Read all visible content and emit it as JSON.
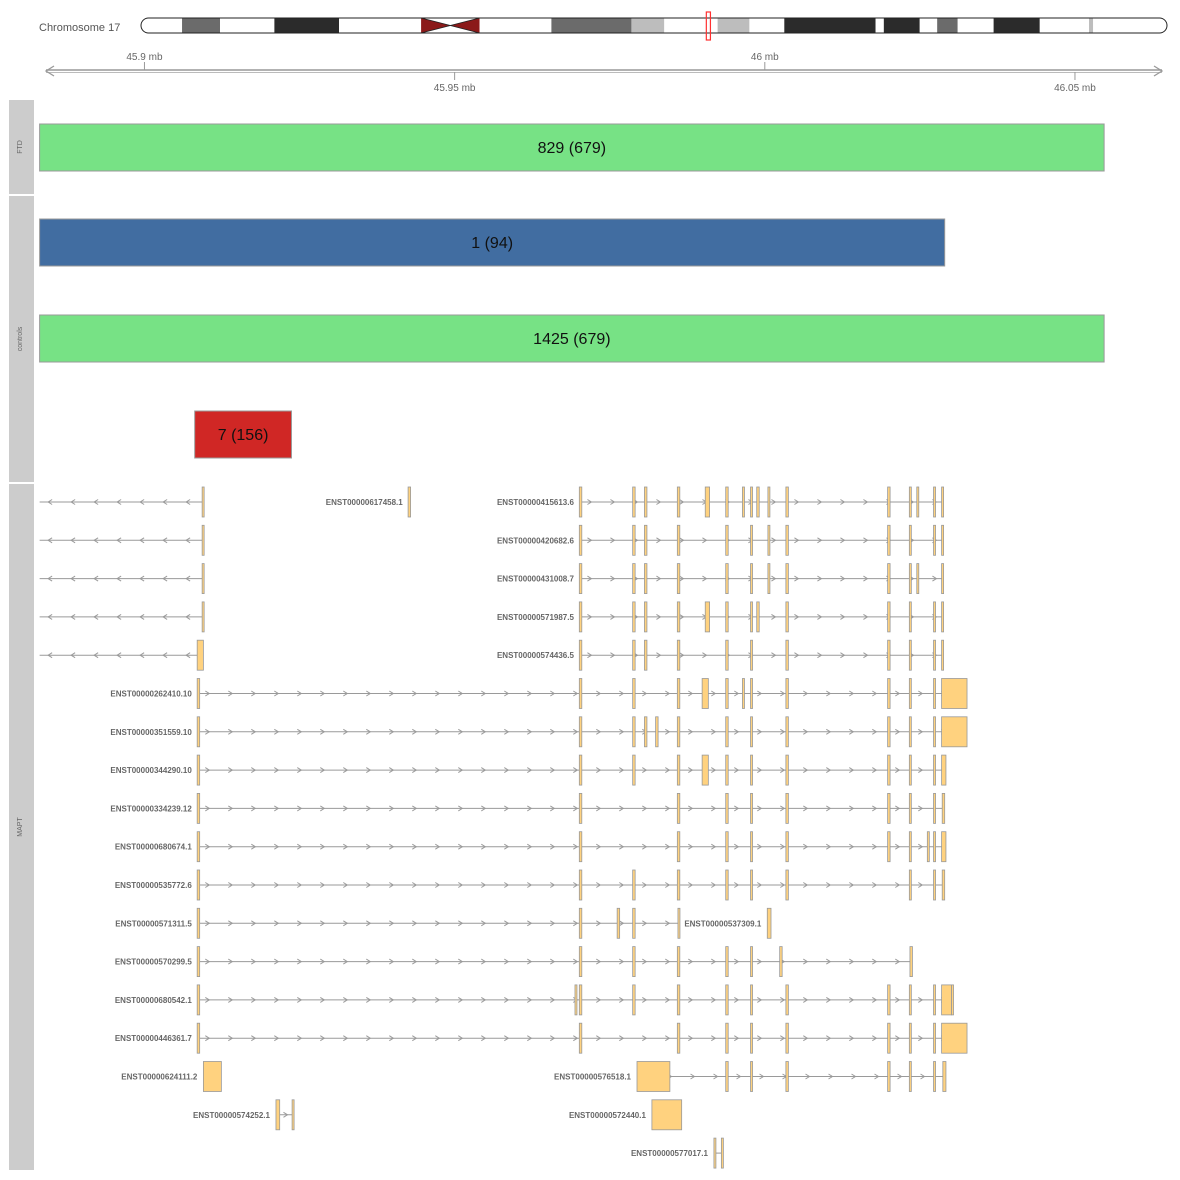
{
  "ideogram": {
    "chromosome_label": "Chromosome 17",
    "centromere_color": "#8b1a1a",
    "highlight_color": "#ff3030",
    "bands": [
      {
        "start": 0.0,
        "end": 0.04,
        "stain": "white"
      },
      {
        "start": 0.04,
        "end": 0.077,
        "stain": "gray"
      },
      {
        "start": 0.077,
        "end": 0.13,
        "stain": "white"
      },
      {
        "start": 0.13,
        "end": 0.193,
        "stain": "black"
      },
      {
        "start": 0.193,
        "end": 0.273,
        "stain": "white"
      },
      {
        "start": 0.273,
        "end": 0.33,
        "stain": "centromere"
      },
      {
        "start": 0.33,
        "end": 0.4,
        "stain": "white"
      },
      {
        "start": 0.4,
        "end": 0.478,
        "stain": "gray"
      },
      {
        "start": 0.478,
        "end": 0.51,
        "stain": "lightgray"
      },
      {
        "start": 0.51,
        "end": 0.562,
        "stain": "white"
      },
      {
        "start": 0.562,
        "end": 0.593,
        "stain": "lightgray"
      },
      {
        "start": 0.593,
        "end": 0.627,
        "stain": "white"
      },
      {
        "start": 0.627,
        "end": 0.716,
        "stain": "black"
      },
      {
        "start": 0.716,
        "end": 0.724,
        "stain": "white"
      },
      {
        "start": 0.724,
        "end": 0.759,
        "stain": "black"
      },
      {
        "start": 0.759,
        "end": 0.776,
        "stain": "white"
      },
      {
        "start": 0.776,
        "end": 0.796,
        "stain": "gray"
      },
      {
        "start": 0.796,
        "end": 0.831,
        "stain": "white"
      },
      {
        "start": 0.831,
        "end": 0.876,
        "stain": "black"
      },
      {
        "start": 0.876,
        "end": 0.924,
        "stain": "white"
      },
      {
        "start": 0.924,
        "end": 0.928,
        "stain": "lightgray"
      },
      {
        "start": 0.928,
        "end": 1.0,
        "stain": "white"
      }
    ],
    "highlight": {
      "start": 0.551,
      "end": 0.555
    }
  },
  "axis": {
    "domain_mb": [
      45.883,
      46.06
    ],
    "ticks_top": [
      {
        "value": 45.9,
        "label": "45.9 mb"
      },
      {
        "value": 46.0,
        "label": "46 mb"
      }
    ],
    "ticks_bottom": [
      {
        "value": 45.95,
        "label": "45.95 mb"
      },
      {
        "value": 46.05,
        "label": "46.05 mb"
      }
    ]
  },
  "tracks": [
    {
      "name": "FTD"
    },
    {
      "name": "controls"
    },
    {
      "name": "MAPT"
    }
  ],
  "data_tracks": [
    {
      "track": "FTD",
      "label": "829 (679)",
      "start": 45.8831,
      "end": 46.0547,
      "color": "#77e285"
    },
    {
      "track": "controls",
      "label": "1 (94)",
      "start": 45.8831,
      "end": 46.029,
      "color": "#416da1"
    },
    {
      "track": "controls",
      "label": "1425 (679)",
      "start": 45.8831,
      "end": 46.0547,
      "color": "#77e285"
    },
    {
      "track": "controls",
      "label": "7 (156)",
      "start": 45.9081,
      "end": 45.9237,
      "color": "#d02725"
    }
  ],
  "transcripts": [
    {
      "id": "",
      "row": 0,
      "strand": "-",
      "start": 45.8831,
      "end": 45.9095,
      "exons": [
        [
          45.9093,
          45.9096
        ]
      ]
    },
    {
      "id": "ENST00000617458.1",
      "row": 0,
      "strand": "+",
      "start": 45.9426,
      "end": 45.9428,
      "exons": [
        [
          45.9425,
          45.9429
        ]
      ]
    },
    {
      "id": "ENST00000415613.6",
      "row": 0,
      "strand": "+",
      "start": 45.9702,
      "end": 46.0287,
      "exons": [
        [
          45.9701,
          45.9705
        ],
        [
          45.9787,
          45.9791
        ],
        [
          45.9806,
          45.981
        ],
        [
          45.9859,
          45.9863
        ],
        [
          45.9904,
          45.9911
        ],
        [
          45.9937,
          45.9941
        ],
        [
          45.9964,
          45.9967
        ],
        [
          45.9977,
          45.998
        ],
        [
          45.9987,
          45.9991
        ],
        [
          46.0005,
          46.0008
        ],
        [
          46.0034,
          46.0038
        ],
        [
          46.0198,
          46.0202
        ],
        [
          46.0233,
          46.0236
        ],
        [
          46.0245,
          46.0248
        ],
        [
          46.0272,
          46.0275
        ],
        [
          46.0285,
          46.0288
        ]
      ]
    },
    {
      "id": "",
      "row": 1,
      "strand": "-",
      "start": 45.8831,
      "end": 45.9095,
      "exons": [
        [
          45.9093,
          45.9096
        ]
      ]
    },
    {
      "id": "ENST00000420682.6",
      "row": 1,
      "strand": "+",
      "start": 45.9702,
      "end": 46.0287,
      "exons": [
        [
          45.9701,
          45.9705
        ],
        [
          45.9787,
          45.9791
        ],
        [
          45.9806,
          45.981
        ],
        [
          45.9859,
          45.9863
        ],
        [
          45.9937,
          45.9941
        ],
        [
          45.9977,
          45.998
        ],
        [
          46.0005,
          46.0008
        ],
        [
          46.0034,
          46.0038
        ],
        [
          46.0198,
          46.0202
        ],
        [
          46.0233,
          46.0236
        ],
        [
          46.0272,
          46.0275
        ],
        [
          46.0285,
          46.0288
        ]
      ]
    },
    {
      "id": "",
      "row": 2,
      "strand": "-",
      "start": 45.8831,
      "end": 45.9095,
      "exons": [
        [
          45.9093,
          45.9096
        ]
      ]
    },
    {
      "id": "ENST00000431008.7",
      "row": 2,
      "strand": "+",
      "start": 45.9702,
      "end": 46.0287,
      "exons": [
        [
          45.9701,
          45.9705
        ],
        [
          45.9787,
          45.9791
        ],
        [
          45.9806,
          45.981
        ],
        [
          45.9859,
          45.9863
        ],
        [
          45.9937,
          45.9941
        ],
        [
          45.9977,
          45.998
        ],
        [
          46.0005,
          46.0008
        ],
        [
          46.0034,
          46.0038
        ],
        [
          46.0198,
          46.0202
        ],
        [
          46.0233,
          46.0236
        ],
        [
          46.0245,
          46.0248
        ],
        [
          46.0285,
          46.0288
        ]
      ]
    },
    {
      "id": "",
      "row": 3,
      "strand": "-",
      "start": 45.8831,
      "end": 45.9095,
      "exons": [
        [
          45.9093,
          45.9096
        ]
      ]
    },
    {
      "id": "ENST00000571987.5",
      "row": 3,
      "strand": "+",
      "start": 45.9702,
      "end": 46.0287,
      "exons": [
        [
          45.9701,
          45.9705
        ],
        [
          45.9787,
          45.9791
        ],
        [
          45.9806,
          45.981
        ],
        [
          45.9859,
          45.9863
        ],
        [
          45.9904,
          45.9911
        ],
        [
          45.9937,
          45.9941
        ],
        [
          45.9977,
          45.998
        ],
        [
          45.9987,
          45.9991
        ],
        [
          46.0034,
          46.0038
        ],
        [
          46.0198,
          46.0202
        ],
        [
          46.0233,
          46.0236
        ],
        [
          46.0272,
          46.0275
        ],
        [
          46.0285,
          46.0288
        ]
      ]
    },
    {
      "id": "",
      "row": 4,
      "strand": "-",
      "start": 45.8831,
      "end": 45.9095,
      "exons": [
        [
          45.9085,
          45.9095
        ]
      ]
    },
    {
      "id": "ENST00000574436.5",
      "row": 4,
      "strand": "+",
      "start": 45.9702,
      "end": 46.0287,
      "exons": [
        [
          45.9701,
          45.9705
        ],
        [
          45.9787,
          45.9791
        ],
        [
          45.9806,
          45.981
        ],
        [
          45.9859,
          45.9863
        ],
        [
          45.9937,
          45.9941
        ],
        [
          45.9977,
          45.998
        ],
        [
          46.0034,
          46.0038
        ],
        [
          46.0198,
          46.0202
        ],
        [
          46.0233,
          46.0236
        ],
        [
          46.0272,
          46.0275
        ],
        [
          46.0285,
          46.0288
        ]
      ]
    },
    {
      "id": "ENST00000262410.10",
      "row": 5,
      "strand": "+",
      "start": 45.9086,
      "end": 46.0326,
      "exons": [
        [
          45.9085,
          45.9089
        ],
        [
          45.9701,
          45.9705
        ],
        [
          45.9787,
          45.9791
        ],
        [
          45.9859,
          45.9863
        ],
        [
          45.9899,
          45.9909
        ],
        [
          45.9937,
          45.9941
        ],
        [
          45.9964,
          45.9967
        ],
        [
          45.9977,
          45.998
        ],
        [
          46.0034,
          46.0038
        ],
        [
          46.0198,
          46.0202
        ],
        [
          46.0233,
          46.0236
        ],
        [
          46.0272,
          46.0275
        ],
        [
          46.0285,
          46.0326
        ]
      ]
    },
    {
      "id": "ENST00000351559.10",
      "row": 6,
      "strand": "+",
      "start": 45.9086,
      "end": 46.0326,
      "exons": [
        [
          45.9085,
          45.9089
        ],
        [
          45.9701,
          45.9705
        ],
        [
          45.9787,
          45.9791
        ],
        [
          45.9806,
          45.981
        ],
        [
          45.9824,
          45.9828
        ],
        [
          45.9859,
          45.9863
        ],
        [
          45.9937,
          45.9941
        ],
        [
          45.9977,
          45.998
        ],
        [
          46.0034,
          46.0038
        ],
        [
          46.0198,
          46.0202
        ],
        [
          46.0233,
          46.0236
        ],
        [
          46.0272,
          46.0275
        ],
        [
          46.0285,
          46.0326
        ]
      ]
    },
    {
      "id": "ENST00000344290.10",
      "row": 7,
      "strand": "+",
      "start": 45.9086,
      "end": 46.0292,
      "exons": [
        [
          45.9085,
          45.9089
        ],
        [
          45.9701,
          45.9705
        ],
        [
          45.9787,
          45.9791
        ],
        [
          45.9859,
          45.9863
        ],
        [
          45.9899,
          45.9909
        ],
        [
          45.9937,
          45.9941
        ],
        [
          45.9977,
          45.998
        ],
        [
          46.0034,
          46.0038
        ],
        [
          46.0198,
          46.0202
        ],
        [
          46.0233,
          46.0236
        ],
        [
          46.0272,
          46.0275
        ],
        [
          46.0285,
          46.0292
        ]
      ]
    },
    {
      "id": "ENST00000334239.12",
      "row": 8,
      "strand": "+",
      "start": 45.9086,
      "end": 46.029,
      "exons": [
        [
          45.9085,
          45.9089
        ],
        [
          45.9701,
          45.9705
        ],
        [
          45.9859,
          45.9863
        ],
        [
          45.9937,
          45.9941
        ],
        [
          45.9977,
          45.998
        ],
        [
          46.0034,
          46.0038
        ],
        [
          46.0198,
          46.0202
        ],
        [
          46.0233,
          46.0236
        ],
        [
          46.0272,
          46.0275
        ],
        [
          46.0286,
          46.029
        ]
      ]
    },
    {
      "id": "ENST00000680674.1",
      "row": 9,
      "strand": "+",
      "start": 45.9086,
      "end": 46.0292,
      "exons": [
        [
          45.9085,
          45.9089
        ],
        [
          45.9701,
          45.9705
        ],
        [
          45.9859,
          45.9863
        ],
        [
          45.9937,
          45.9941
        ],
        [
          45.9977,
          45.998
        ],
        [
          46.0034,
          46.0038
        ],
        [
          46.0198,
          46.0202
        ],
        [
          46.0233,
          46.0236
        ],
        [
          46.0262,
          46.0265
        ],
        [
          46.0272,
          46.0275
        ],
        [
          46.0285,
          46.0292
        ]
      ]
    },
    {
      "id": "ENST00000535772.6",
      "row": 10,
      "strand": "+",
      "start": 45.9086,
      "end": 46.029,
      "exons": [
        [
          45.9085,
          45.9089
        ],
        [
          45.9701,
          45.9705
        ],
        [
          45.9787,
          45.9791
        ],
        [
          45.9859,
          45.9863
        ],
        [
          45.9937,
          45.9941
        ],
        [
          45.9977,
          45.998
        ],
        [
          46.0034,
          46.0038
        ],
        [
          46.0233,
          46.0236
        ],
        [
          46.0272,
          46.0275
        ],
        [
          46.0286,
          46.029
        ]
      ]
    },
    {
      "id": "ENST00000571311.5",
      "row": 11,
      "strand": "+",
      "start": 45.9086,
      "end": 45.9863,
      "exons": [
        [
          45.9085,
          45.9089
        ],
        [
          45.9701,
          45.9705
        ],
        [
          45.9762,
          45.9766
        ],
        [
          45.9787,
          45.9791
        ],
        [
          45.986,
          45.9863
        ]
      ]
    },
    {
      "id": "ENST00000537309.1",
      "row": 11,
      "strand": "+",
      "start": 46.0004,
      "end": 46.001,
      "exons": [
        [
          46.0004,
          46.001
        ]
      ]
    },
    {
      "id": "ENST00000570299.5",
      "row": 12,
      "strand": "+",
      "start": 45.9086,
      "end": 46.0238,
      "exons": [
        [
          45.9085,
          45.9089
        ],
        [
          45.9701,
          45.9705
        ],
        [
          45.9787,
          45.9791
        ],
        [
          45.9859,
          45.9863
        ],
        [
          45.9937,
          45.9941
        ],
        [
          45.9977,
          45.998
        ],
        [
          46.0024,
          46.0028
        ],
        [
          46.0234,
          46.0238
        ]
      ]
    },
    {
      "id": "ENST00000680542.1",
      "row": 13,
      "strand": "+",
      "start": 45.9086,
      "end": 46.0304,
      "exons": [
        [
          45.9085,
          45.9089
        ],
        [
          45.9694,
          45.9697
        ],
        [
          45.9701,
          45.9705
        ],
        [
          45.9787,
          45.9791
        ],
        [
          45.9859,
          45.9863
        ],
        [
          45.9937,
          45.9941
        ],
        [
          45.9977,
          45.998
        ],
        [
          46.0034,
          46.0038
        ],
        [
          46.0198,
          46.0202
        ],
        [
          46.0233,
          46.0236
        ],
        [
          46.0272,
          46.0275
        ],
        [
          46.0285,
          46.0301
        ],
        [
          46.0301,
          46.0304
        ]
      ]
    },
    {
      "id": "ENST00000446361.7",
      "row": 14,
      "strand": "+",
      "start": 45.9086,
      "end": 46.0326,
      "exons": [
        [
          45.9085,
          45.9089
        ],
        [
          45.9701,
          45.9705
        ],
        [
          45.9859,
          45.9863
        ],
        [
          45.9937,
          45.9941
        ],
        [
          45.9977,
          45.998
        ],
        [
          46.0034,
          46.0038
        ],
        [
          46.0198,
          46.0202
        ],
        [
          46.0233,
          46.0236
        ],
        [
          46.0272,
          46.0275
        ],
        [
          46.0285,
          46.0326
        ]
      ]
    },
    {
      "id": "ENST00000624111.2",
      "row": 15,
      "strand": "+",
      "start": 45.9095,
      "end": 45.9124,
      "exons": [
        [
          45.9095,
          45.9124
        ]
      ]
    },
    {
      "id": "ENST00000576518.1",
      "row": 15,
      "strand": "+",
      "start": 45.9794,
      "end": 46.0292,
      "exons": [
        [
          45.9794,
          45.9847
        ],
        [
          45.9937,
          45.9941
        ],
        [
          45.9977,
          45.998
        ],
        [
          46.0034,
          46.0038
        ],
        [
          46.0198,
          46.0202
        ],
        [
          46.0233,
          46.0236
        ],
        [
          46.0272,
          46.0275
        ],
        [
          46.0287,
          46.0292
        ]
      ]
    },
    {
      "id": "ENST00000574252.1",
      "row": 16,
      "strand": "+",
      "start": 45.9212,
      "end": 45.924,
      "exons": [
        [
          45.9212,
          45.9218
        ],
        [
          45.9238,
          45.924
        ]
      ]
    },
    {
      "id": "ENST00000572440.1",
      "row": 16,
      "strand": "+",
      "start": 45.9818,
      "end": 45.9866,
      "exons": [
        [
          45.9818,
          45.9866
        ]
      ]
    },
    {
      "id": "ENST00000577017.1",
      "row": 17,
      "strand": "+",
      "start": 45.9918,
      "end": 45.9932,
      "exons": [
        [
          45.9918,
          45.992
        ],
        [
          45.993,
          45.9932
        ]
      ]
    }
  ]
}
